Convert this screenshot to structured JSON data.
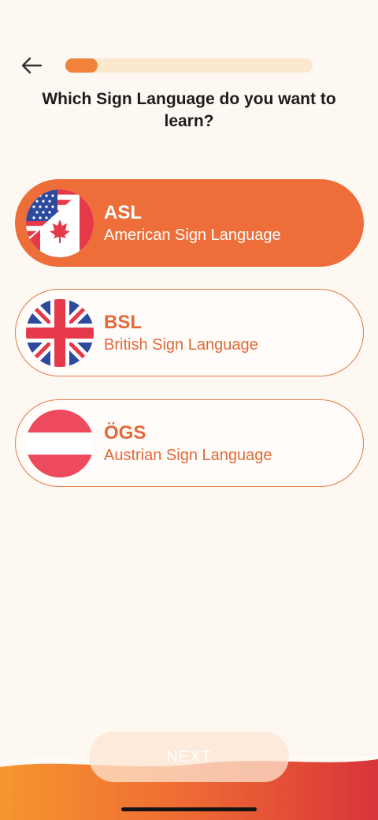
{
  "header": {
    "progress_percent": 13
  },
  "question": "Which Sign Language do you want to learn?",
  "options": [
    {
      "code": "ASL",
      "name": "American Sign Language",
      "selected": true,
      "flag_icon": "us-canada-flag-icon"
    },
    {
      "code": "BSL",
      "name": "British Sign Language",
      "selected": false,
      "flag_icon": "uk-flag-icon"
    },
    {
      "code": "ÖGS",
      "name": "Austrian Sign Language",
      "selected": false,
      "flag_icon": "austria-flag-icon"
    }
  ],
  "footer": {
    "next_label": "NEXT"
  },
  "colors": {
    "background": "#FEF8F2",
    "accent": "#EE6E3A",
    "progress_fill": "#F0823A",
    "progress_track": "#FCE7CF"
  }
}
